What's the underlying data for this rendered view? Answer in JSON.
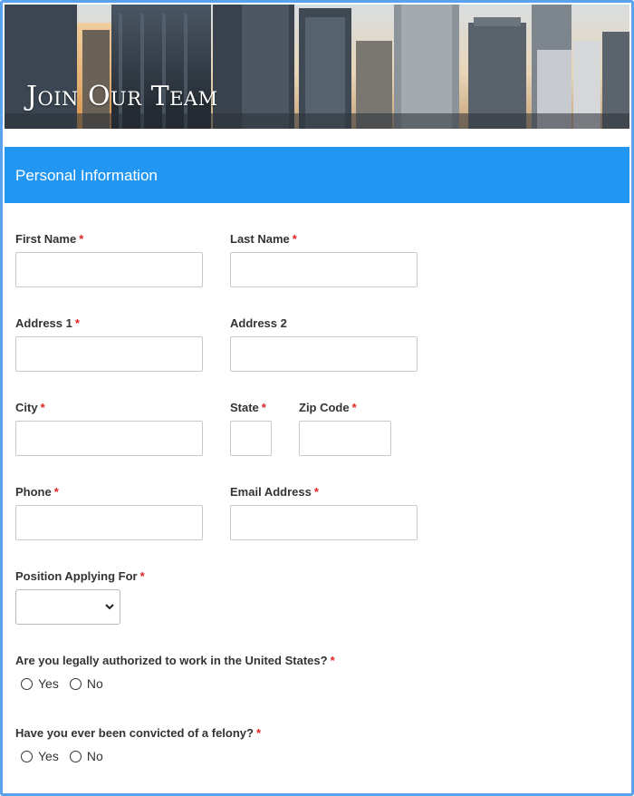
{
  "banner": {
    "title": "Join Our Team"
  },
  "section": {
    "title": "Personal Information"
  },
  "fields": {
    "first_name": {
      "label": "First Name",
      "required_mark": "*"
    },
    "last_name": {
      "label": "Last Name",
      "required_mark": "*"
    },
    "address1": {
      "label": "Address 1",
      "required_mark": "*"
    },
    "address2": {
      "label": "Address 2"
    },
    "city": {
      "label": "City",
      "required_mark": "*"
    },
    "state": {
      "label": "State",
      "required_mark": "*"
    },
    "zip": {
      "label": "Zip Code",
      "required_mark": "*"
    },
    "phone": {
      "label": "Phone",
      "required_mark": "*"
    },
    "email": {
      "label": "Email Address",
      "required_mark": "*"
    },
    "position": {
      "label": "Position Applying For",
      "required_mark": "*",
      "selected": ""
    }
  },
  "questions": {
    "authorized": {
      "label": "Are you legally authorized to work in the United States?",
      "required_mark": "*",
      "options": [
        "Yes",
        "No"
      ]
    },
    "felony": {
      "label": "Have you ever been convicted of a felony?",
      "required_mark": "*",
      "options": [
        "Yes",
        "No"
      ]
    }
  },
  "icons": {
    "dropdown": "chevron-down-icon",
    "radio": "radio-unchecked-icon"
  },
  "colors": {
    "accent": "#2196f3",
    "frame_border": "#5aa2ee",
    "required": "#e02424",
    "input_border": "#c9c9c9"
  }
}
